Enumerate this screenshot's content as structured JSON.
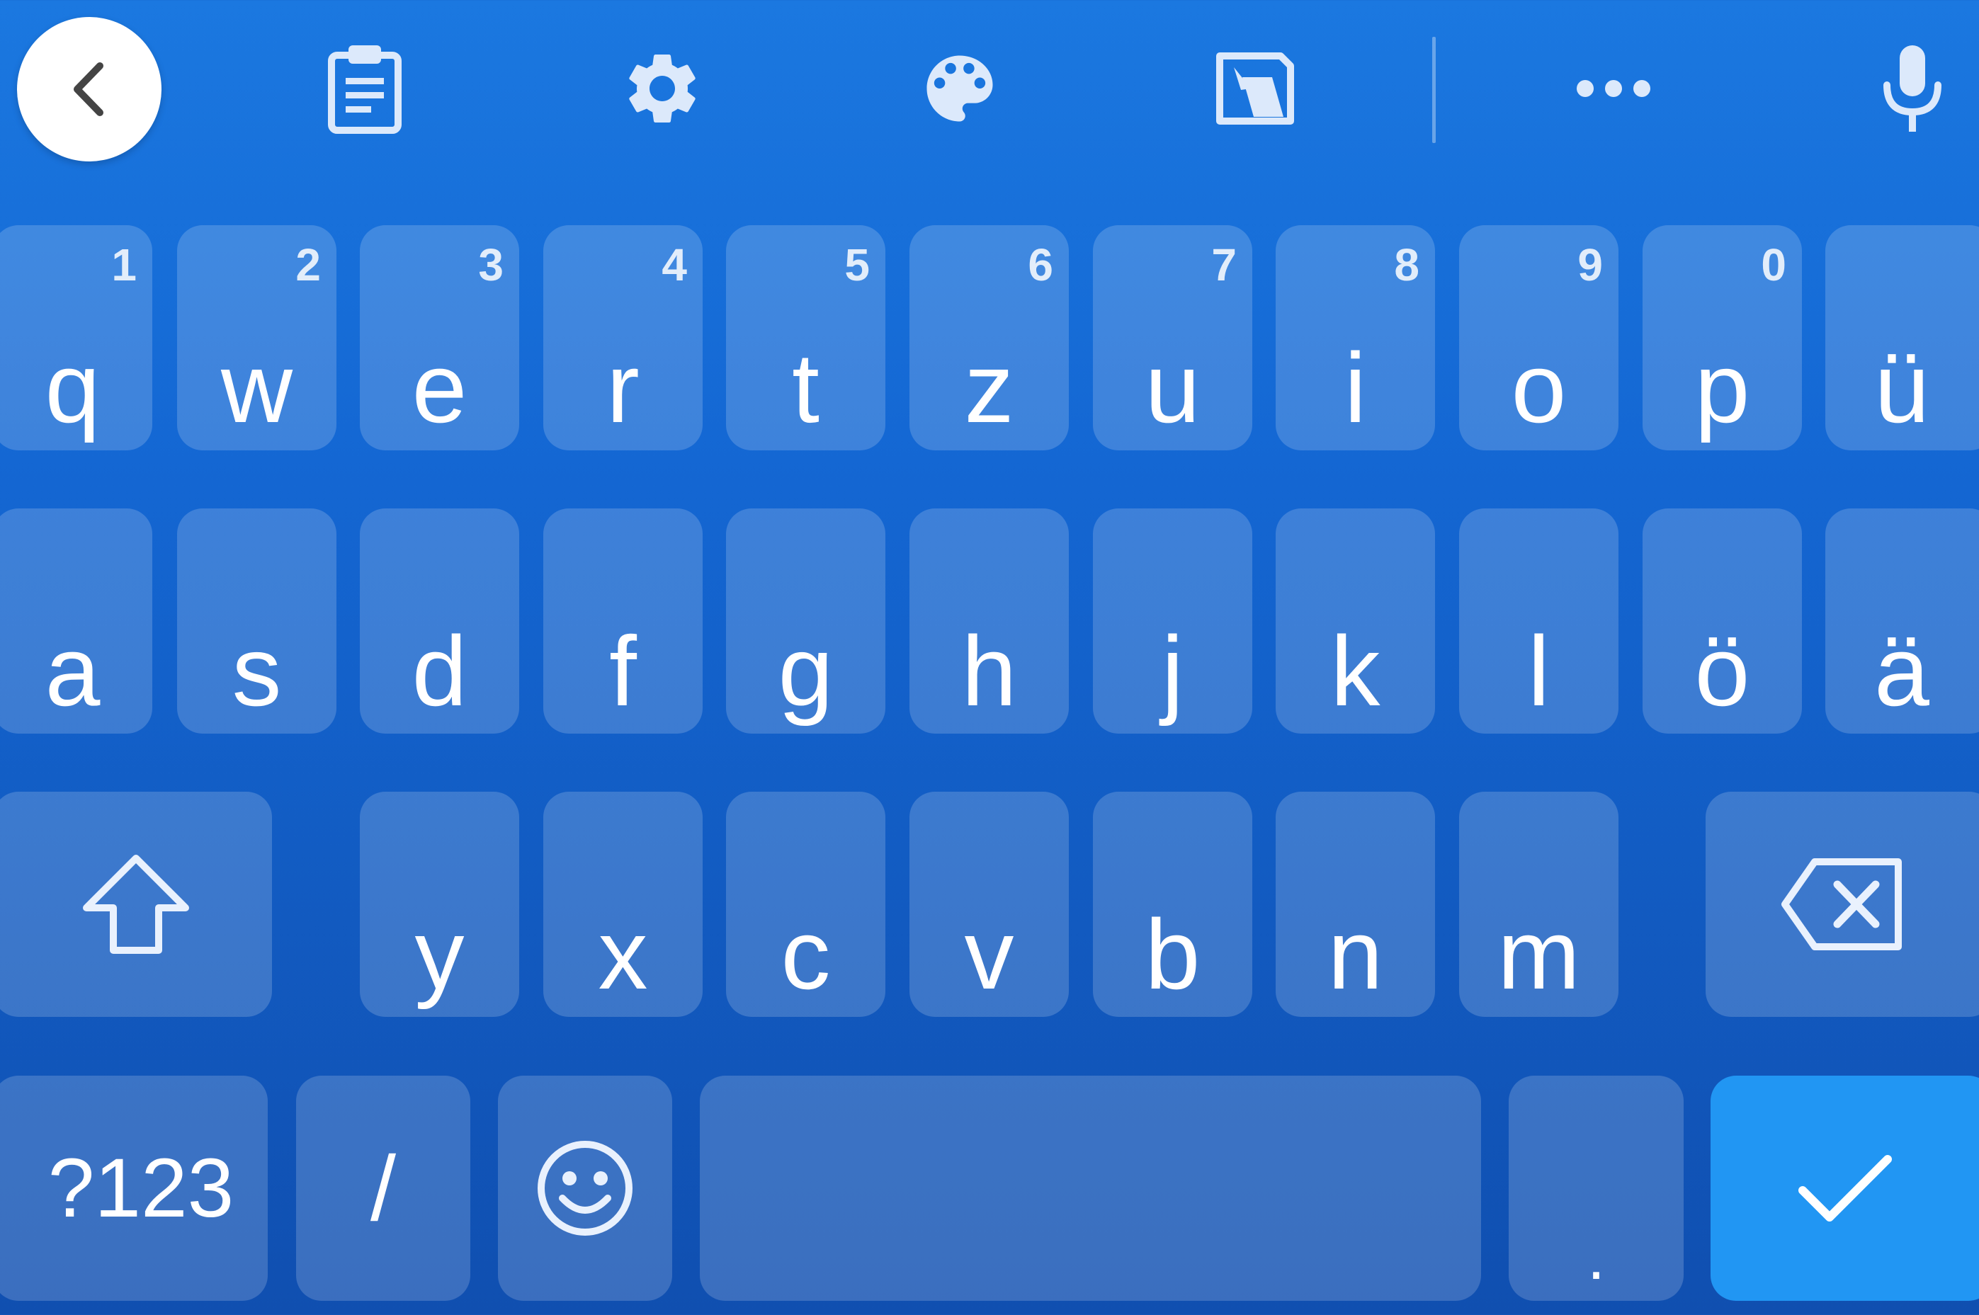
{
  "toolbar": {
    "icons": [
      "chevron-left-icon",
      "clipboard-icon",
      "gear-icon",
      "palette-icon",
      "text-select-icon",
      "more-dots-icon",
      "microphone-icon"
    ]
  },
  "keyboard": {
    "row1": [
      {
        "letter": "q",
        "hint": "1"
      },
      {
        "letter": "w",
        "hint": "2"
      },
      {
        "letter": "e",
        "hint": "3"
      },
      {
        "letter": "r",
        "hint": "4"
      },
      {
        "letter": "t",
        "hint": "5"
      },
      {
        "letter": "z",
        "hint": "6"
      },
      {
        "letter": "u",
        "hint": "7"
      },
      {
        "letter": "i",
        "hint": "8"
      },
      {
        "letter": "o",
        "hint": "9"
      },
      {
        "letter": "p",
        "hint": "0"
      },
      {
        "letter": "ü",
        "hint": ""
      }
    ],
    "row2": [
      "a",
      "s",
      "d",
      "f",
      "g",
      "h",
      "j",
      "k",
      "l",
      "ö",
      "ä"
    ],
    "row3": [
      "y",
      "x",
      "c",
      "v",
      "b",
      "n",
      "m"
    ],
    "bottom": {
      "symbols_label": "?123",
      "slash_label": "/",
      "period_label": "."
    }
  },
  "colors": {
    "background_top": "#1b78e0",
    "background_bottom": "#104fb0",
    "enter_key": "#2196f3"
  }
}
